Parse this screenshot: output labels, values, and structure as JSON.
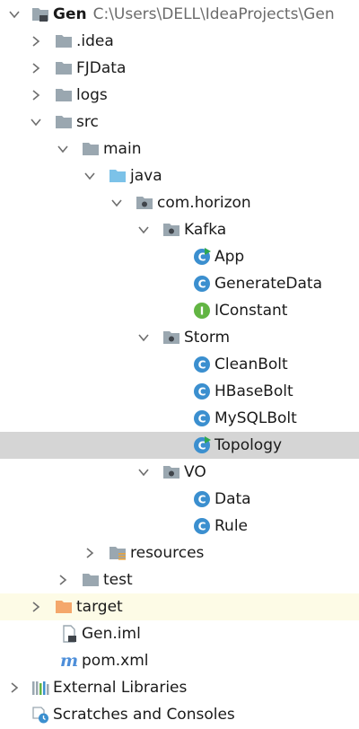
{
  "colors": {
    "folder": "#9aa7b0",
    "source_folder": "#7cc2e8",
    "excluded_folder": "#f4a76b",
    "class_icon": "#3b8fcf",
    "interface_icon": "#62b543",
    "run_marker": "#2fa84f",
    "maven": "#4d8ed9",
    "selected_row": "#d5d5d5",
    "excluded_row": "#fdfbe6",
    "text_gray": "#6b6b6b"
  },
  "tree": {
    "project": {
      "name": "Gen",
      "path": "C:\\Users\\DELL\\IdeaProjects\\Gen",
      "icon": "project-folder-icon"
    },
    "idea": {
      "label": ".idea",
      "icon": "folder-icon"
    },
    "fjdata": {
      "label": "FJData",
      "icon": "folder-icon"
    },
    "logs": {
      "label": "logs",
      "icon": "folder-icon"
    },
    "src": {
      "label": "src",
      "icon": "folder-icon"
    },
    "main": {
      "label": "main",
      "icon": "folder-icon"
    },
    "java": {
      "label": "java",
      "icon": "source-folder-icon"
    },
    "pkg_root": {
      "label": "com.horizon",
      "icon": "package-icon"
    },
    "kafka": {
      "label": "Kafka",
      "icon": "package-icon"
    },
    "app": {
      "label": "App",
      "icon": "class-runnable-icon"
    },
    "generate_data": {
      "label": "GenerateData",
      "icon": "class-icon"
    },
    "iconstant": {
      "label": "IConstant",
      "icon": "interface-icon"
    },
    "storm": {
      "label": "Storm",
      "icon": "package-icon"
    },
    "clean_bolt": {
      "label": "CleanBolt",
      "icon": "class-icon"
    },
    "hbase_bolt": {
      "label": "HBaseBolt",
      "icon": "class-icon"
    },
    "mysql_bolt": {
      "label": "MySQLBolt",
      "icon": "class-icon"
    },
    "topology": {
      "label": "Topology",
      "icon": "class-runnable-icon"
    },
    "vo": {
      "label": "VO",
      "icon": "package-icon"
    },
    "data": {
      "label": "Data",
      "icon": "class-icon"
    },
    "rule": {
      "label": "Rule",
      "icon": "class-icon"
    },
    "resources": {
      "label": "resources",
      "icon": "resources-folder-icon"
    },
    "test": {
      "label": "test",
      "icon": "folder-icon"
    },
    "target": {
      "label": "target",
      "icon": "excluded-folder-icon"
    },
    "gen_iml": {
      "label": "Gen.iml",
      "icon": "iml-file-icon"
    },
    "pom": {
      "label": "pom.xml",
      "icon": "maven-icon"
    },
    "external_libraries": {
      "label": "External Libraries",
      "icon": "libraries-icon"
    },
    "scratches": {
      "label": "Scratches and Consoles",
      "icon": "scratches-icon"
    }
  }
}
